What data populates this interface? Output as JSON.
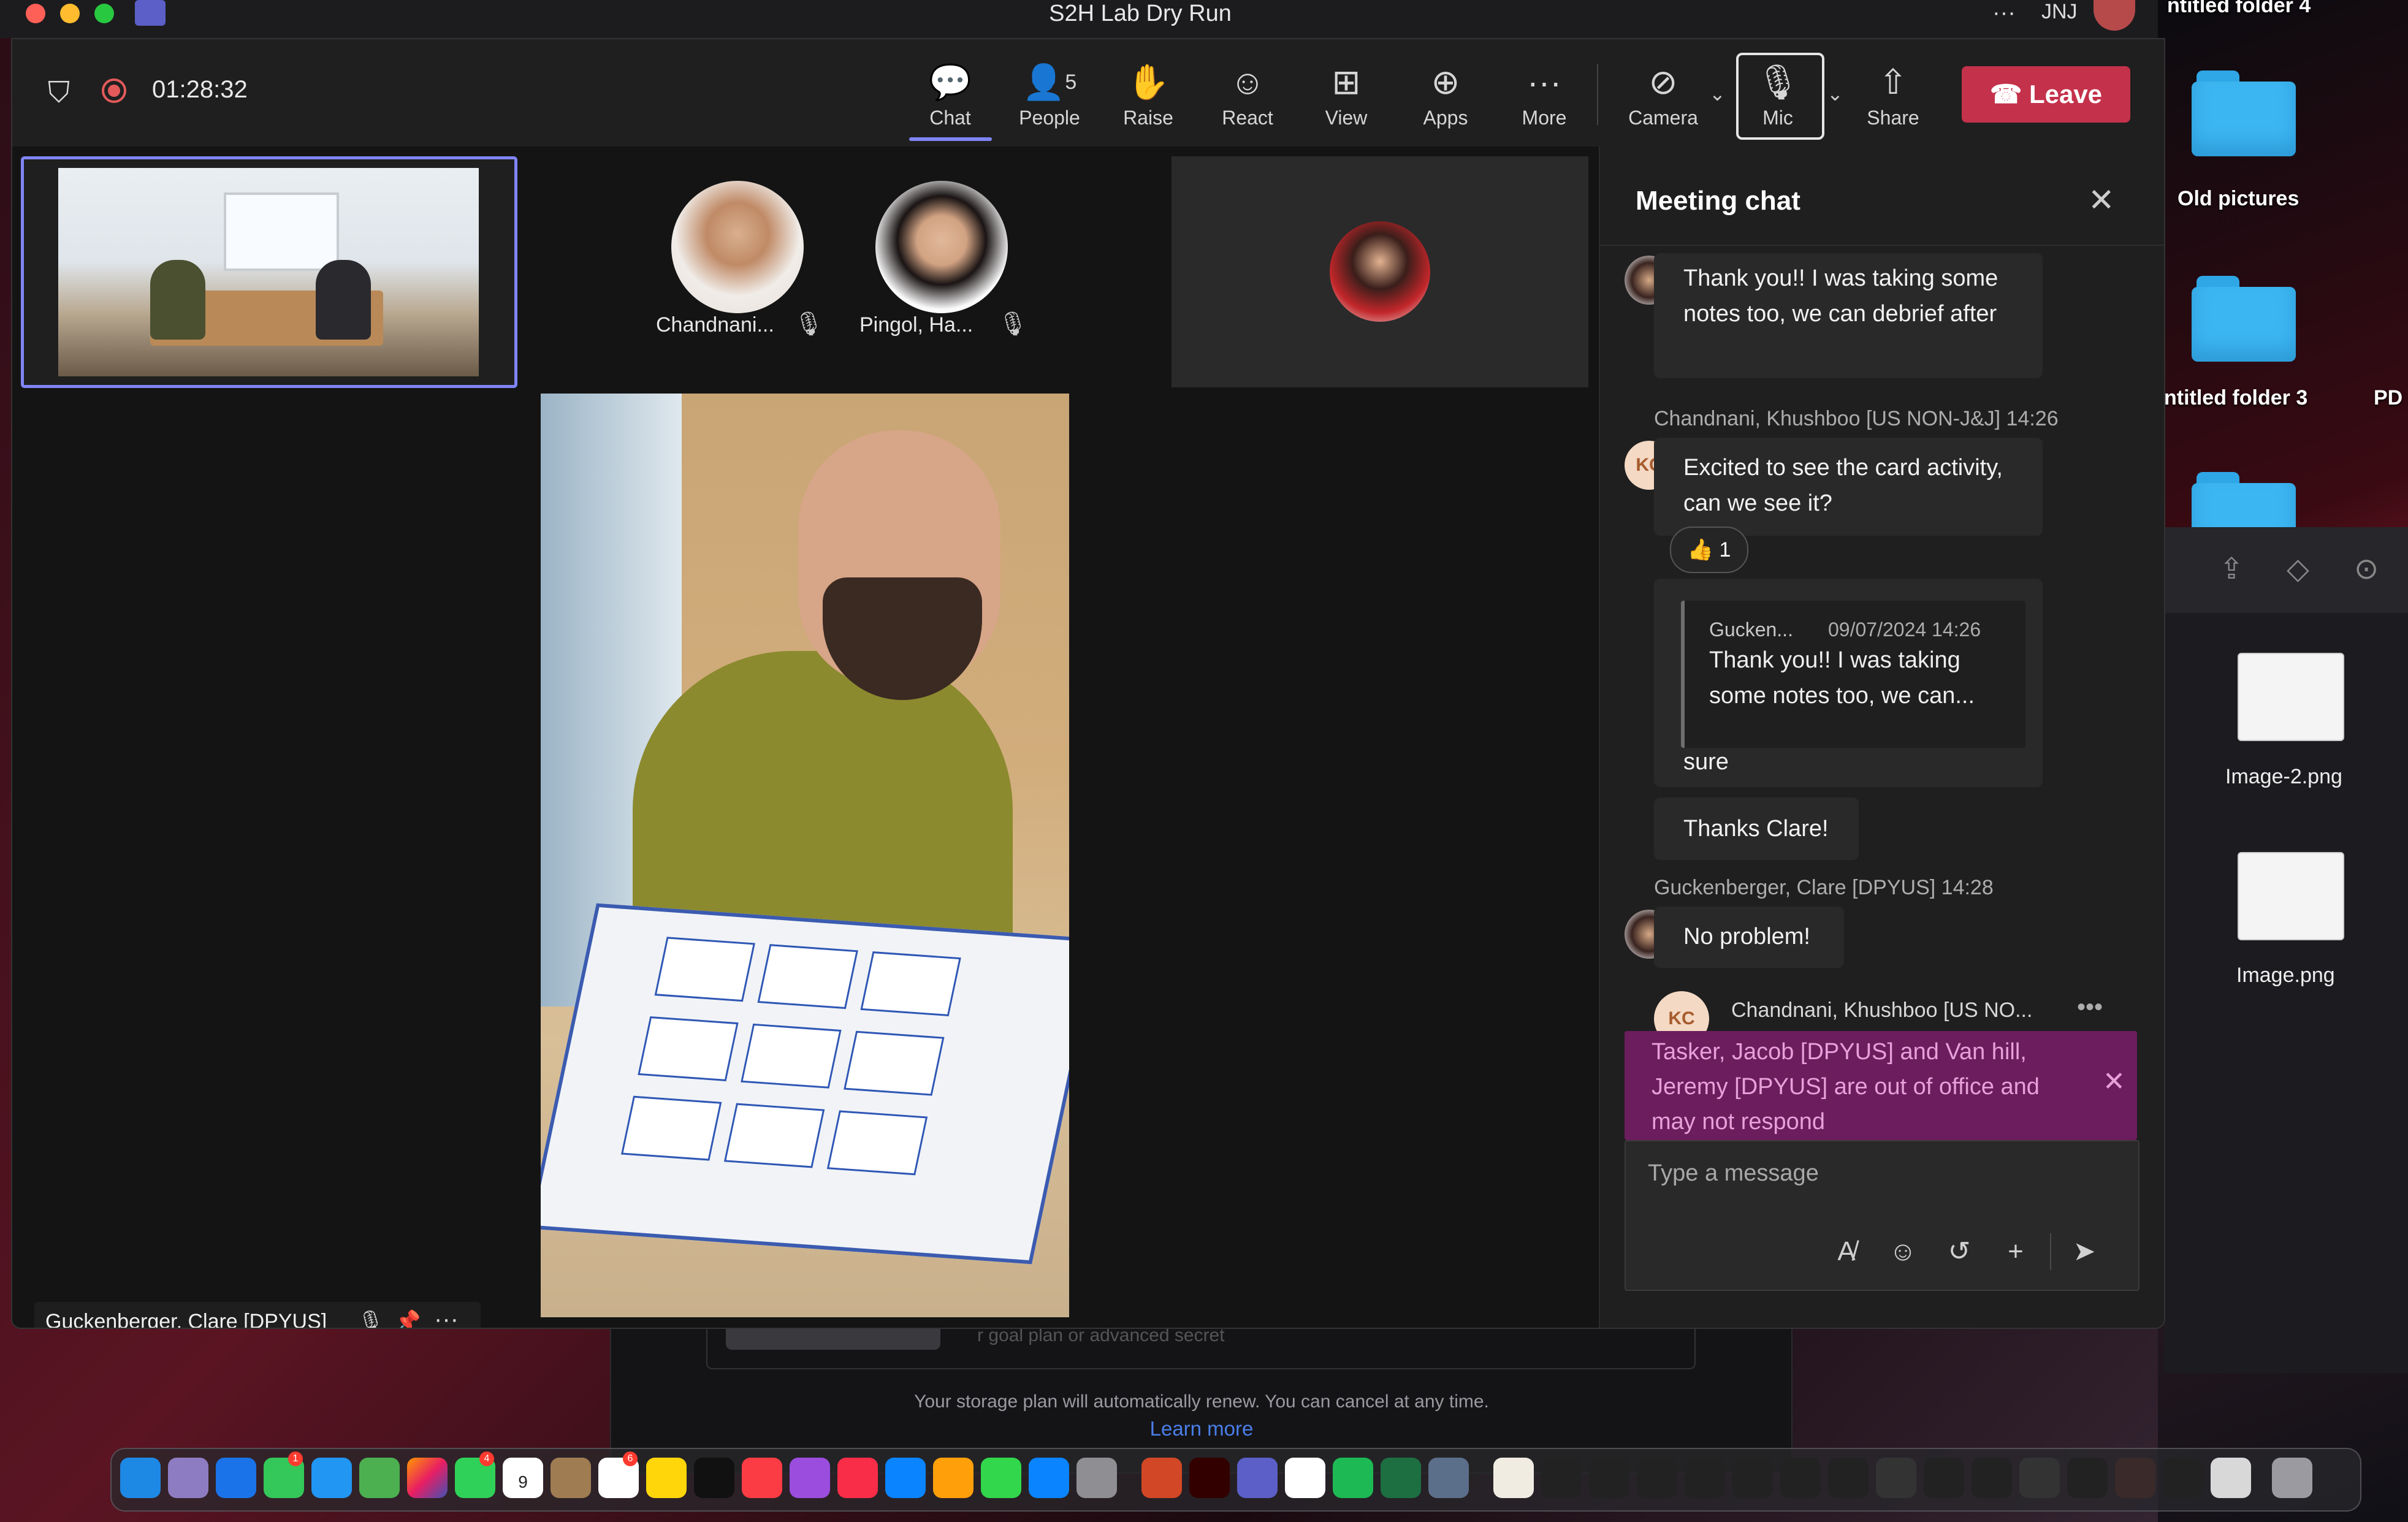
{
  "window": {
    "title": "S2H Lab Dry Run"
  },
  "menubar": {
    "user_initials": "JNJ"
  },
  "meeting": {
    "elapsed": "01:28:32",
    "toolbar": {
      "chat": "Chat",
      "people": "People",
      "people_count": "5",
      "raise": "Raise",
      "react": "React",
      "view": "View",
      "apps": "Apps",
      "more": "More",
      "camera": "Camera",
      "mic": "Mic",
      "share": "Share",
      "leave": "Leave"
    },
    "participants": [
      {
        "name": "Chandnani...",
        "muted": true
      },
      {
        "name": "Pingol, Ha...",
        "muted": true
      }
    ],
    "speaker_name": "Guckenberger, Clare [DPYUS]"
  },
  "chat": {
    "title": "Meeting chat",
    "messages": [
      {
        "text": "Thank you!! I was taking some notes too, we can debrief after"
      },
      {
        "author": "Chandnani, Khushboo [US NON-J&J]",
        "time": "14:26",
        "avatar": "KC",
        "text": "Excited to see the card activity, can we see it?",
        "reaction": {
          "emoji": "👍",
          "count": "1"
        }
      },
      {
        "quote_author": "Gucken...",
        "quote_time": "09/07/2024 14:26",
        "quote_text": "Thank you!! I was taking some notes too, we can...",
        "text": "sure"
      },
      {
        "text": "Thanks Clare!"
      },
      {
        "author": "Guckenberger, Clare [DPYUS]",
        "time": "14:28",
        "text": "No problem!"
      },
      {
        "author": "Chandnani, Khushboo [US NO...",
        "avatar": "KC",
        "typing": "•••"
      }
    ],
    "ooo_banner": "Tasker, Jacob [DPYUS] and Van hill, Jeremy [DPYUS] are out of office and may not respond",
    "compose_placeholder": "Type a message"
  },
  "desktop": {
    "folders": [
      "ntitled folder 4",
      "Old pictures",
      "ntitled folder 3"
    ],
    "extra_label": "PD",
    "files": [
      "Image-2.png",
      "Image.png"
    ]
  },
  "background_app": {
    "text_partial": "r goal plan or advanced secret",
    "storage_notice": "Your storage plan will automatically renew. You can cancel at any time.",
    "learn_more": "Learn more"
  },
  "dock": {
    "badges": {
      "messages": "1",
      "facetime": "4",
      "calendar_date": "9",
      "reminders": "6"
    }
  }
}
